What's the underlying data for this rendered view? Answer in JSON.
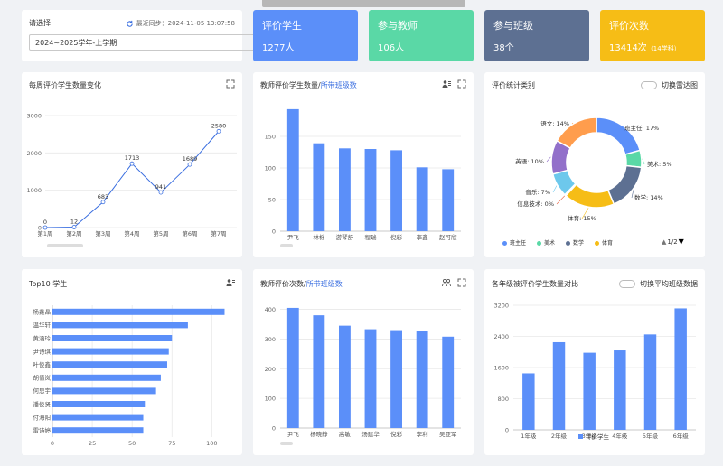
{
  "filter": {
    "label": "请选择",
    "sync_text": "最近同步：2024-11-05 13:07:58",
    "term_value": "2024~2025学年-上学期"
  },
  "stats": [
    {
      "title": "评价学生",
      "value": "1277人",
      "color": "#5b8ff9"
    },
    {
      "title": "参与教师",
      "value": "106人",
      "color": "#5ad8a6"
    },
    {
      "title": "参与班级",
      "value": "38个",
      "color": "#5d7092"
    },
    {
      "title": "评价次数",
      "value": "13414次",
      "suffix": "（14学科）",
      "color": "#f6bd16"
    }
  ],
  "weekly": {
    "title": "每周评价学生数量变化"
  },
  "teacher_students": {
    "title_prefix": "教师评价学生数量/",
    "title_link": "所带班级数"
  },
  "category": {
    "title": "评价统计类别",
    "toggle_label": "切换雷达图",
    "pager": "1/2"
  },
  "top10": {
    "title": "Top10 学生"
  },
  "teacher_times": {
    "title_prefix": "教师评价次数/",
    "title_link": "所带班级数"
  },
  "grades": {
    "title": "各年级被评价学生数量对比",
    "toggle_label": "切换平均班级数据"
  },
  "chart_data": [
    {
      "type": "line",
      "x": [
        "第1周",
        "第2周",
        "第3周",
        "第4周",
        "第5周",
        "第6周",
        "第7周"
      ],
      "values": [
        0,
        12,
        683,
        1713,
        941,
        1689,
        2580
      ],
      "ylim": [
        0,
        3000
      ],
      "yticks": [
        0,
        1000,
        2000,
        3000
      ]
    },
    {
      "type": "bar",
      "categories": [
        "尹飞",
        "林栎",
        "游琴舒",
        "程瑞",
        "倪彩",
        "李鑫",
        "赵可欣"
      ],
      "values": [
        193,
        139,
        131,
        130,
        128,
        101,
        98
      ],
      "ylim": [
        0,
        200
      ],
      "yticks": [
        0,
        50,
        100,
        150
      ]
    },
    {
      "type": "pie",
      "slices": [
        {
          "name": "班主任",
          "value": 17,
          "label": "班主任: 17%",
          "color": "#5b8ff9"
        },
        {
          "name": "美术",
          "value": 5,
          "label": "美术: 5%",
          "color": "#5ad8a6"
        },
        {
          "name": "数学",
          "value": 14,
          "label": "数学: 14%",
          "color": "#5d7092"
        },
        {
          "name": "体育",
          "value": 15,
          "label": "体育: 15%",
          "color": "#f6bd16"
        },
        {
          "name": "信息技术",
          "value": 0.4,
          "label": "信息技术: 0%",
          "color": "#e8684a"
        },
        {
          "name": "音乐",
          "value": 7,
          "label": "音乐: 7%",
          "color": "#6dc8ec"
        },
        {
          "name": "英语",
          "value": 10,
          "label": "英语: 10%",
          "color": "#9270ca"
        },
        {
          "name": "语文",
          "value": 14,
          "label": "语文: 14%",
          "color": "#ff9d4d"
        }
      ],
      "legend": [
        "班主任",
        "美术",
        "数学",
        "体育"
      ]
    },
    {
      "type": "bar",
      "orientation": "horizontal",
      "categories": [
        "杨鑫晶",
        "温华轩",
        "黄涵玲",
        "尹诗琪",
        "叶俊鑫",
        "胡倩岚",
        "何思宇",
        "潘俊贤",
        "付海阳",
        "雷诗婷"
      ],
      "values": [
        108,
        85,
        75,
        73,
        72,
        68,
        65,
        58,
        57,
        57
      ],
      "xlim": [
        0,
        110
      ],
      "xticks": [
        0,
        25,
        50,
        75,
        100
      ]
    },
    {
      "type": "bar",
      "categories": [
        "尹飞",
        "杨晓静",
        "高敏",
        "汤建华",
        "倪彩",
        "李利",
        "吴亚军"
      ],
      "values": [
        405,
        380,
        345,
        333,
        330,
        326,
        308
      ],
      "ylim": [
        0,
        420
      ],
      "yticks": [
        0,
        100,
        200,
        300,
        400
      ]
    },
    {
      "type": "bar",
      "categories": [
        "1年级",
        "2年级",
        "3年级",
        "4年级",
        "5年级",
        "6年级"
      ],
      "values": [
        1450,
        2250,
        1980,
        2040,
        2450,
        3120
      ],
      "ylim": [
        0,
        3200
      ],
      "yticks": [
        0,
        800,
        1600,
        2400,
        3200
      ],
      "legend": [
        "评价学生"
      ]
    }
  ]
}
